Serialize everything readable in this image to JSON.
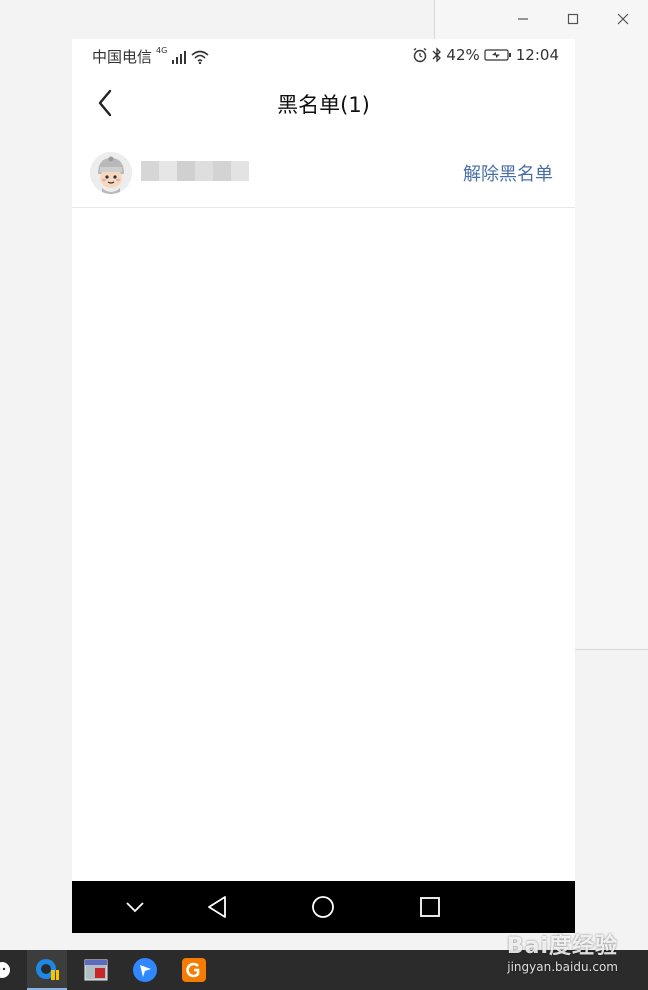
{
  "status_bar": {
    "carrier": "中国电信",
    "network": "4G",
    "battery": "42%",
    "time": "12:04"
  },
  "header": {
    "title": "黑名单(1)"
  },
  "blocklist": {
    "items": [
      {
        "action_label": "解除黑名单"
      }
    ]
  },
  "watermark": {
    "brand": "Bai度经验",
    "url": "jingyan.baidu.com"
  },
  "colors": {
    "link": "#4a6fa5",
    "navbar": "#000000",
    "taskbar": "#2b2b2b"
  }
}
